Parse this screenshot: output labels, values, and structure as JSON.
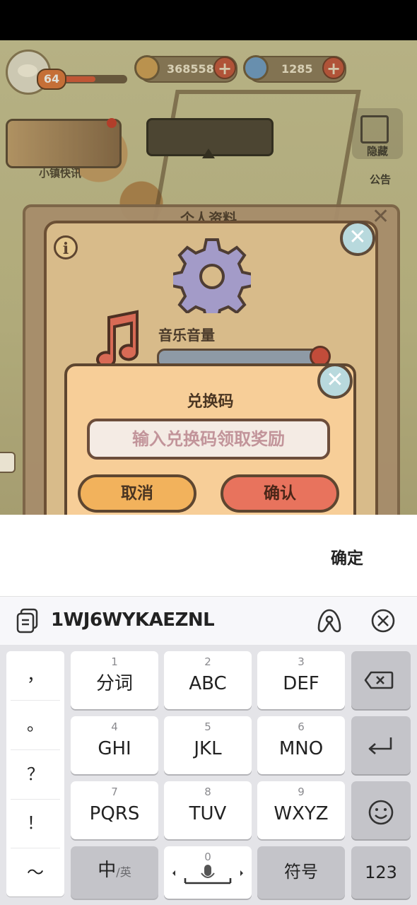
{
  "hud": {
    "level": "64",
    "xp_fraction": 0.55,
    "coins": "368558",
    "gems": "1285",
    "plus": "+",
    "news_label": "小镇快讯",
    "hide_label": "隐藏",
    "side_label": "公告"
  },
  "settings": {
    "title": "个人资料",
    "info_symbol": "i",
    "music_volume_label": "音乐音量",
    "music_volume": 0.95,
    "close_symbol": "✕"
  },
  "redeem": {
    "title": "兑换码",
    "input_placeholder": "输入兑换码领取奖励",
    "cancel_label": "取消",
    "confirm_label": "确认"
  },
  "ime": {
    "done_label": "确定",
    "clipboard_text": "1WJ6WYKAEZNL"
  },
  "keyboard": {
    "punctuation": [
      "，",
      "。",
      "？",
      "！",
      "～"
    ],
    "rows": [
      [
        {
          "num": "1",
          "label": "分词"
        },
        {
          "num": "2",
          "label": "ABC"
        },
        {
          "num": "3",
          "label": "DEF"
        }
      ],
      [
        {
          "num": "4",
          "label": "GHI"
        },
        {
          "num": "5",
          "label": "JKL"
        },
        {
          "num": "6",
          "label": "MNO"
        }
      ],
      [
        {
          "num": "7",
          "label": "PQRS"
        },
        {
          "num": "8",
          "label": "TUV"
        },
        {
          "num": "9",
          "label": "WXYZ"
        }
      ]
    ],
    "lang_main": "中",
    "lang_alt": "/英",
    "space_num": "0",
    "symbols_label": "符号",
    "numbers_label": "123",
    "icons": {
      "backspace": "backspace-icon",
      "enter": "enter-icon",
      "emoji": "emoji-icon",
      "mic": "microphone-icon"
    }
  },
  "colors": {
    "accent_red": "#e8735d",
    "accent_orange": "#f2b25c",
    "panel": "#f7ce98"
  }
}
